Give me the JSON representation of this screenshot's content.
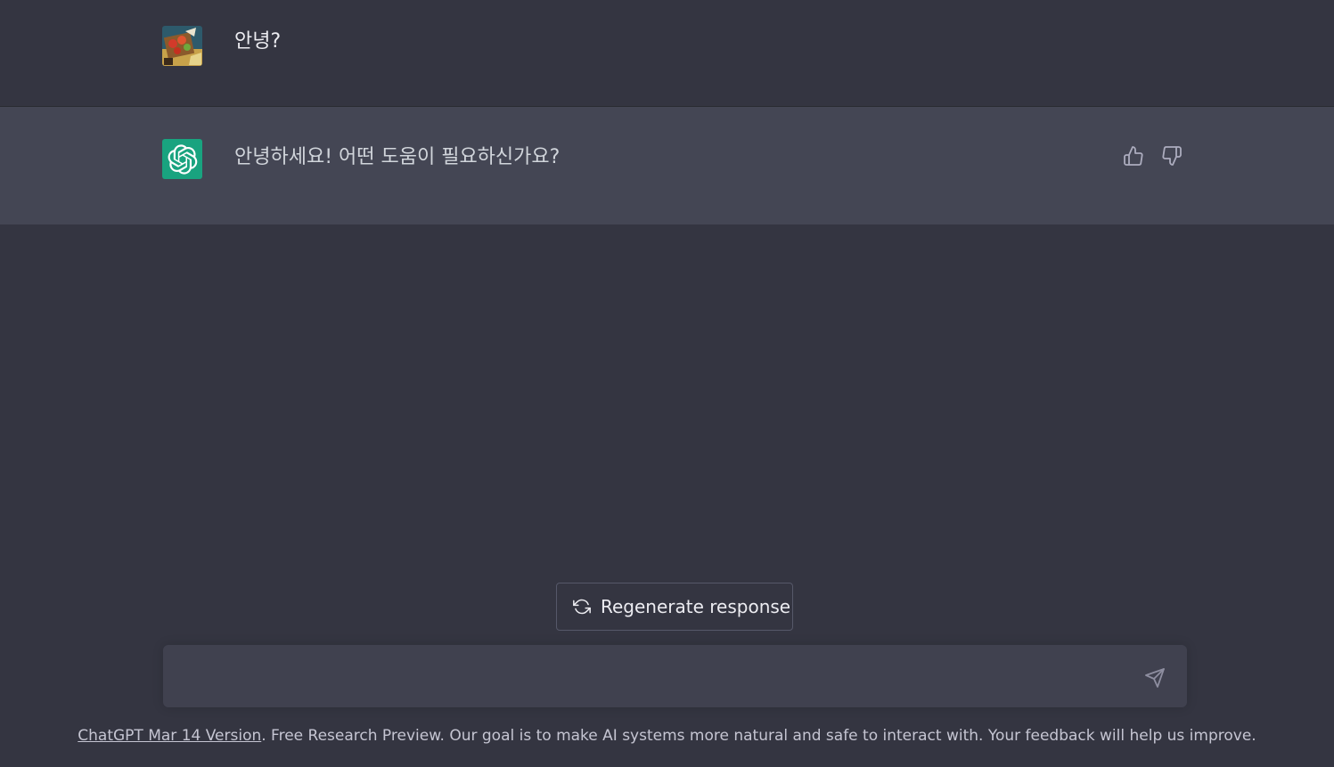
{
  "conversation": {
    "user_message": "안녕?",
    "assistant_message": "안녕하세요! 어떤 도움이 필요하신가요?",
    "user_avatar_icon": "user-avatar-image",
    "assistant_avatar_icon": "openai-logo-icon",
    "feedback": {
      "thumbs_up_icon": "thumbs-up-icon",
      "thumbs_down_icon": "thumbs-down-icon"
    }
  },
  "regenerate": {
    "label": "Regenerate response",
    "icon": "refresh-icon"
  },
  "composer": {
    "value": "",
    "placeholder": "",
    "send_icon": "send-icon"
  },
  "footer": {
    "link_text": "ChatGPT Mar 14 Version",
    "text": ". Free Research Preview. Our goal is to make AI systems more natural and safe to interact with. Your feedback will help us improve."
  },
  "colors": {
    "background": "#343541",
    "assistant_row": "#444654",
    "composer": "#40414f",
    "brand_green": "#19a37f"
  }
}
